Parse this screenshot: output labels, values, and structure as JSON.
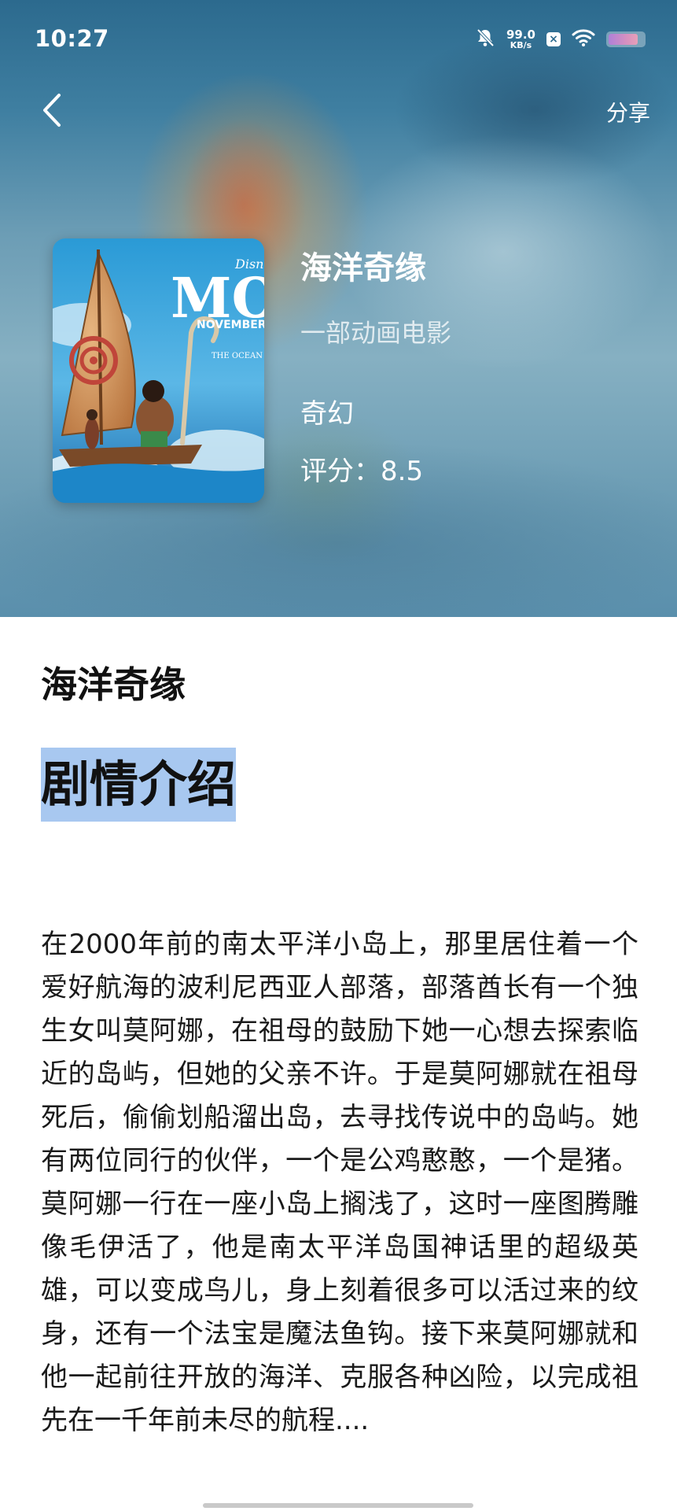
{
  "status_bar": {
    "time": "10:27",
    "net_speed_value": "99.0",
    "net_speed_unit": "KB/s",
    "battery_level_fraction": 0.85,
    "icons": [
      "bell-muted-icon",
      "x-app-icon",
      "wifi-icon",
      "battery-icon"
    ]
  },
  "nav": {
    "back_icon": "chevron-left-icon",
    "share_label": "分享"
  },
  "movie": {
    "title": "海洋奇缘",
    "subtitle": "一部动画电影",
    "genre": "奇幻",
    "rating_label": "评分：8.5"
  },
  "poster": {
    "brand_text": "Disney",
    "title_text": "MO",
    "month_text": "NOVEMBER",
    "tagline_text": "THE OCEAN"
  },
  "section_title": "海洋奇缘",
  "heading": "剧情介绍",
  "synopsis": "在2000年前的南太平洋小岛上，那里居住着一个爱好航海的波利尼西亚人部落，部落酋长有一个独生女叫莫阿娜，在祖母的鼓励下她一心想去探索临近的岛屿，但她的父亲不许。于是莫阿娜就在祖母死后，偷偷划船溜出岛，去寻找传说中的岛屿。她有两位同行的伙伴，一个是公鸡憨憨，一个是猪。莫阿娜一行在一座小岛上搁浅了，这时一座图腾雕像毛伊活了，他是南太平洋岛国神话里的超级英雄，可以变成鸟儿，身上刻着很多可以活过来的纹身，还有一个法宝是魔法鱼钩。接下来莫阿娜就和他一起前往开放的海洋、克服各种凶险，以完成祖先在一千年前未尽的航程....",
  "colors": {
    "heading_highlight": "#a8c8f0",
    "hero_top": "#2c6a8e",
    "hero_bottom": "#5a8fac"
  }
}
